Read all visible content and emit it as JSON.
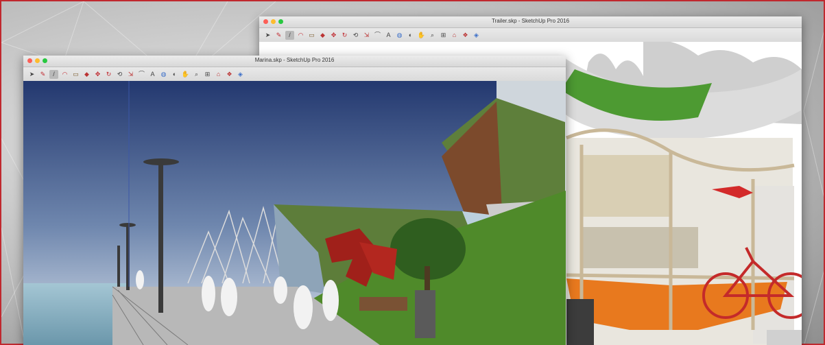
{
  "windows": {
    "trailer": {
      "title": "Trailer.skp - SketchUp Pro 2016"
    },
    "marina": {
      "title": "Marina.skp - SketchUp Pro 2016"
    }
  },
  "colors": {
    "frame_border": "#c0282e",
    "close": "#fc5f57",
    "minimize": "#fdbc2e",
    "zoom": "#28c840",
    "sky_top": "#23386f",
    "sky_bottom": "#d7e0ea",
    "water": "#86afc0",
    "grass": "#4f8a2a",
    "sculpture": "#a0201a",
    "canoe": "#4d9a32",
    "floor": "#e8791e"
  },
  "toolbar_icons": [
    "select-icon",
    "eraser-icon",
    "pencil-icon",
    "arc-icon",
    "shape-icon",
    "push-pull-icon",
    "move-icon",
    "rotate-icon",
    "offset-icon",
    "scale-icon",
    "tape-measure-icon",
    "text-icon",
    "paint-bucket-icon",
    "orbit-icon",
    "pan-icon",
    "zoom-icon",
    "zoom-extents-icon",
    "warehouse-icon",
    "extension-icon",
    "layout-icon"
  ]
}
